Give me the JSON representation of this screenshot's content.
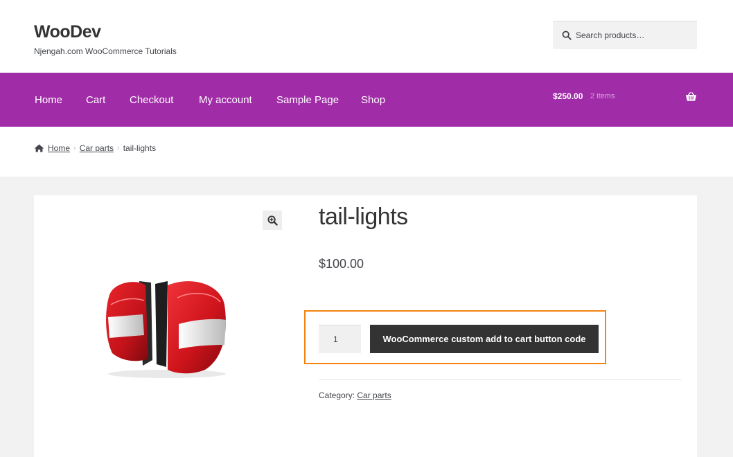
{
  "site": {
    "title": "WooDev",
    "tagline": "Njengah.com WooCommerce Tutorials"
  },
  "search": {
    "placeholder": "Search products…"
  },
  "nav": {
    "items": [
      {
        "label": "Home"
      },
      {
        "label": "Cart"
      },
      {
        "label": "Checkout"
      },
      {
        "label": "My account"
      },
      {
        "label": "Sample Page"
      },
      {
        "label": "Shop"
      }
    ]
  },
  "cart": {
    "total": "$250.00",
    "count": "2 items"
  },
  "breadcrumb": {
    "home": "Home",
    "category": "Car parts",
    "current": "tail-lights"
  },
  "product": {
    "title": "tail-lights",
    "price": "$100.00",
    "quantity": "1",
    "add_to_cart_label": "WooCommerce custom add to cart button code",
    "category_label": "Category:",
    "category": "Car parts"
  },
  "colors": {
    "nav_background": "#a12ca7",
    "highlight_border": "#f5830f",
    "button_background": "#333333"
  }
}
